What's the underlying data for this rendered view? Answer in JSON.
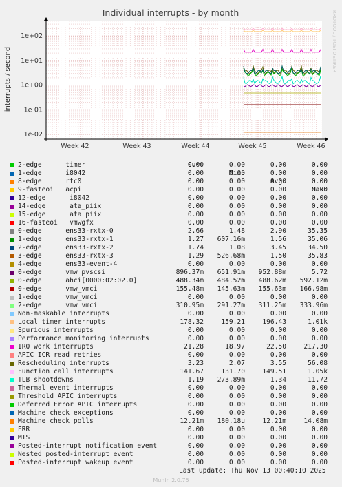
{
  "chart_data": {
    "type": "line",
    "title": "Individual interrupts - by month",
    "ylabel": "interrupts / second",
    "y_scale": "log",
    "y_ticks": [
      "1e-02",
      "1e-01",
      "1e+00",
      "1e+01",
      "1e+02"
    ],
    "y_tick_values": [
      0.01,
      0.1,
      1,
      10,
      100
    ],
    "x_ticks": [
      "Week 42",
      "Week 43",
      "Week 44",
      "Week 45",
      "Week 46"
    ],
    "grid": true,
    "watermark": "RRDTOOL / TOBI OETIKER",
    "series": [
      {
        "name": "Local timer interrupts",
        "color": "#ffb0d0",
        "level": 180,
        "start": "Week 45"
      },
      {
        "name": "Function call interrupts",
        "color": "#ffd080",
        "level": 150,
        "start": "Week 45"
      },
      {
        "name": "IRQ work interrupts",
        "color": "#e000c0",
        "level": 22,
        "start": "Week 45"
      },
      {
        "name": "Rescheduling interrupts",
        "color": "#606000",
        "level": 3.5,
        "start": "Week 45"
      },
      {
        "name": "ens33-rxtx-0",
        "color": "#00b000",
        "level": 2.9,
        "start": "Week 45"
      },
      {
        "name": "ens33-rxtx-2",
        "color": "#006060",
        "level": 3.45,
        "start": "Week 45"
      },
      {
        "name": "TLB shootdowns",
        "color": "#00e0c0",
        "level": 1.34,
        "start": "Week 45"
      },
      {
        "name": "vmw_pvscsi",
        "color": "#8000a0",
        "level": 0.95,
        "start": "Week 45"
      },
      {
        "name": "vmw_vmci",
        "color": "#c0c040",
        "level": 0.48,
        "start": "Week 45"
      },
      {
        "name": "ahci[0000:02:02.0]",
        "color": "#800000",
        "level": 0.16,
        "start": "Week 45"
      },
      {
        "name": "Machine check polls",
        "color": "#e07000",
        "level": 0.0122,
        "start": "Week 45"
      }
    ]
  },
  "legend": {
    "headers": [
      "Cur:",
      "Min:",
      "Avg:",
      "Max:"
    ],
    "rows": [
      {
        "label": "2-edge      timer",
        "color": "#00cc00",
        "cur": "0.00",
        "min": "0.00",
        "avg": "0.00",
        "max": "0.00"
      },
      {
        "label": "1-edge      i8042",
        "color": "#0066b3",
        "cur": "0.00",
        "min": "0.00",
        "avg": "0.00",
        "max": "0.00"
      },
      {
        "label": "8-edge      rtc0",
        "color": "#ff8000",
        "cur": "0.00",
        "min": "0.00",
        "avg": "0.00",
        "max": "0.00"
      },
      {
        "label": "9-fasteoi   acpi",
        "color": "#ffcc00",
        "cur": "0.00",
        "min": "0.00",
        "avg": "0.00",
        "max": "0.00"
      },
      {
        "label": "12-edge      i8042",
        "color": "#330099",
        "cur": "0.00",
        "min": "0.00",
        "avg": "0.00",
        "max": "0.00"
      },
      {
        "label": "14-edge      ata_piix",
        "color": "#990099",
        "cur": "0.00",
        "min": "0.00",
        "avg": "0.00",
        "max": "0.00"
      },
      {
        "label": "15-edge      ata_piix",
        "color": "#ccff00",
        "cur": "0.00",
        "min": "0.00",
        "avg": "0.00",
        "max": "0.00"
      },
      {
        "label": "16-fasteoi   vmwgfx",
        "color": "#ff0000",
        "cur": "0.00",
        "min": "0.00",
        "avg": "0.00",
        "max": "0.00"
      },
      {
        "label": "0-edge      ens33-rxtx-0",
        "color": "#808080",
        "cur": "2.66",
        "min": "1.48",
        "avg": "2.90",
        "max": "35.35"
      },
      {
        "label": "1-edge      ens33-rxtx-1",
        "color": "#008f00",
        "cur": "1.27",
        "min": "607.16m",
        "avg": "1.56",
        "max": "35.06"
      },
      {
        "label": "2-edge      ens33-rxtx-2",
        "color": "#00487d",
        "cur": "1.74",
        "min": "1.08",
        "avg": "3.45",
        "max": "34.50"
      },
      {
        "label": "3-edge      ens33-rxtx-3",
        "color": "#b35a00",
        "cur": "1.29",
        "min": "526.68m",
        "avg": "1.50",
        "max": "35.83"
      },
      {
        "label": "4-edge      ens33-event-4",
        "color": "#b38f00",
        "cur": "0.00",
        "min": "0.00",
        "avg": "0.00",
        "max": "0.00"
      },
      {
        "label": "0-edge      vmw_pvscsi",
        "color": "#6b006b",
        "cur": "896.37m",
        "min": "651.91m",
        "avg": "952.88m",
        "max": "5.72"
      },
      {
        "label": "0-edge      ahci[0000:02:02.0]",
        "color": "#8fb300",
        "cur": "488.34m",
        "min": "484.52m",
        "avg": "488.62m",
        "max": "592.12m"
      },
      {
        "label": "0-edge      vmw_vmci",
        "color": "#b30000",
        "cur": "155.48m",
        "min": "145.63m",
        "avg": "155.63m",
        "max": "166.98m"
      },
      {
        "label": "1-edge      vmw_vmci",
        "color": "#bebebe",
        "cur": "0.00",
        "min": "0.00",
        "avg": "0.00",
        "max": "0.00"
      },
      {
        "label": "2-edge      vmw_vmci",
        "color": "#80ff80",
        "cur": "310.95m",
        "min": "291.27m",
        "avg": "311.25m",
        "max": "333.96m"
      },
      {
        "label": "Non-maskable interrupts",
        "color": "#80c9ff",
        "cur": "0.00",
        "min": "0.00",
        "avg": "0.00",
        "max": "0.00"
      },
      {
        "label": "Local timer interrupts",
        "color": "#ffc080",
        "cur": "178.32",
        "min": "159.21",
        "avg": "196.43",
        "max": "1.01k"
      },
      {
        "label": "Spurious interrupts",
        "color": "#ffe680",
        "cur": "0.00",
        "min": "0.00",
        "avg": "0.00",
        "max": "0.00"
      },
      {
        "label": "Performance monitoring interrupts",
        "color": "#aa80ff",
        "cur": "0.00",
        "min": "0.00",
        "avg": "0.00",
        "max": "0.00"
      },
      {
        "label": "IRQ work interrupts",
        "color": "#ee00cc",
        "cur": "21.28",
        "min": "18.97",
        "avg": "22.50",
        "max": "217.30"
      },
      {
        "label": "APIC ICR read retries",
        "color": "#ff8080",
        "cur": "0.00",
        "min": "0.00",
        "avg": "0.00",
        "max": "0.00"
      },
      {
        "label": "Rescheduling interrupts",
        "color": "#666600",
        "cur": "3.23",
        "min": "2.07",
        "avg": "3.55",
        "max": "56.08"
      },
      {
        "label": "Function call interrupts",
        "color": "#ffbfff",
        "cur": "141.67",
        "min": "131.70",
        "avg": "149.51",
        "max": "1.05k"
      },
      {
        "label": "TLB shootdowns",
        "color": "#00ffcc",
        "cur": "1.19",
        "min": "273.89m",
        "avg": "1.34",
        "max": "11.72"
      },
      {
        "label": "Thermal event interrupts",
        "color": "#cc6699",
        "cur": "0.00",
        "min": "0.00",
        "avg": "0.00",
        "max": "0.00"
      },
      {
        "label": "Threshold APIC interrupts",
        "color": "#999900",
        "cur": "0.00",
        "min": "0.00",
        "avg": "0.00",
        "max": "0.00"
      },
      {
        "label": "Deferred Error APIC interrupts",
        "color": "#00cc00",
        "cur": "0.00",
        "min": "0.00",
        "avg": "0.00",
        "max": "0.00"
      },
      {
        "label": "Machine check exceptions",
        "color": "#0066b3",
        "cur": "0.00",
        "min": "0.00",
        "avg": "0.00",
        "max": "0.00"
      },
      {
        "label": "Machine check polls",
        "color": "#ff8000",
        "cur": "12.21m",
        "min": "180.18u",
        "avg": "12.21m",
        "max": "14.08m"
      },
      {
        "label": "ERR",
        "color": "#ffcc00",
        "cur": "0.00",
        "min": "0.00",
        "avg": "0.00",
        "max": "0.00"
      },
      {
        "label": "MIS",
        "color": "#330099",
        "cur": "0.00",
        "min": "0.00",
        "avg": "0.00",
        "max": "0.00"
      },
      {
        "label": "Posted-interrupt notification event",
        "color": "#990099",
        "cur": "0.00",
        "min": "0.00",
        "avg": "0.00",
        "max": "0.00"
      },
      {
        "label": "Nested posted-interrupt event",
        "color": "#ccff00",
        "cur": "0.00",
        "min": "0.00",
        "avg": "0.00",
        "max": "0.00"
      },
      {
        "label": "Posted-interrupt wakeup event",
        "color": "#ff0000",
        "cur": "0.00",
        "min": "0.00",
        "avg": "0.00",
        "max": "0.00"
      }
    ]
  },
  "footer": {
    "last_update": "Last update: Thu Nov 13 00:40:10 2025",
    "munin": "Munin 2.0.75"
  }
}
